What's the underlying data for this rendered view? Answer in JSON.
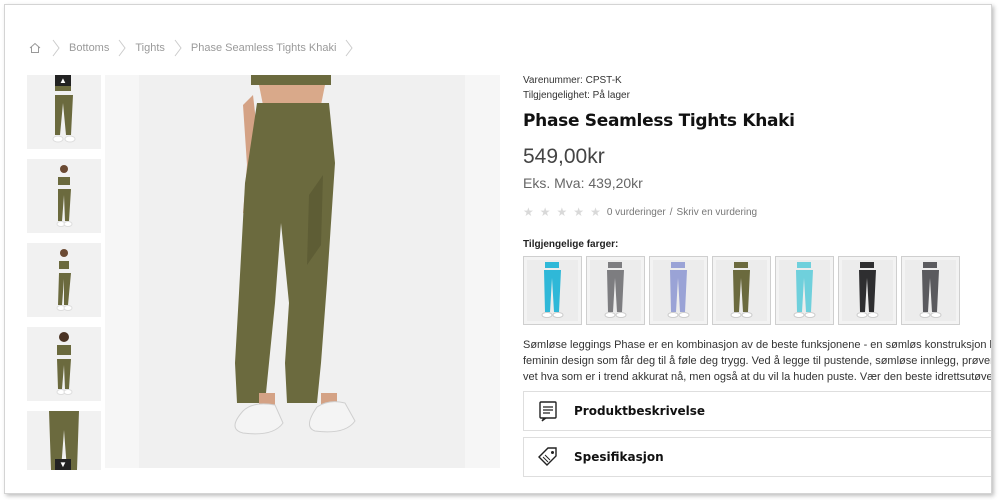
{
  "breadcrumb": {
    "home_icon": "home-icon",
    "items": [
      "Bottoms",
      "Tights",
      "Phase Seamless Tights Khaki"
    ]
  },
  "gallery": {
    "up_icon": "chevron-up-icon",
    "down_icon": "chevron-down-icon",
    "thumbnail_count": 5
  },
  "product": {
    "sku": "Varenummer: CPST-K",
    "availability": "Tilgjengelighet: På lager",
    "title": "Phase Seamless Tights Khaki",
    "price": "549,00kr",
    "price_ex_vat": "Eks. Mva: 439,20kr",
    "rating": {
      "stars": 0,
      "max": 5,
      "reviews_text": "0 vurderinger",
      "separator": "/",
      "write_review": "Skriv en vurdering"
    },
    "colors_label": "Tilgjengelige farger:",
    "swatch_colors": [
      "#2fb8d8",
      "#7d7d80",
      "#9aa3d6",
      "#6b6a3e",
      "#6fd0dc",
      "#2e2e30",
      "#5a5a5e"
    ],
    "description_lines": [
      "Sømløse leggings Phase er en kombinasjon av de beste funksjonene - en sømløs konstruksjon kjent fo",
      "feminin design som får deg til å føle deg trygg. Ved å legge til pustende, sømløse innlegg, prøver vi å g",
      "vet hva som er i trend akkurat nå, men også at du vil la huden puste. Vær den beste idrettsutøveren og"
    ],
    "accordions": [
      {
        "label": "Produktbeskrivelse",
        "icon": "document-list-icon"
      },
      {
        "label": "Spesifikasjon",
        "icon": "tag-icon"
      }
    ]
  },
  "colors": {
    "khaki": "#6b6a3e",
    "background": "#ffffff"
  }
}
